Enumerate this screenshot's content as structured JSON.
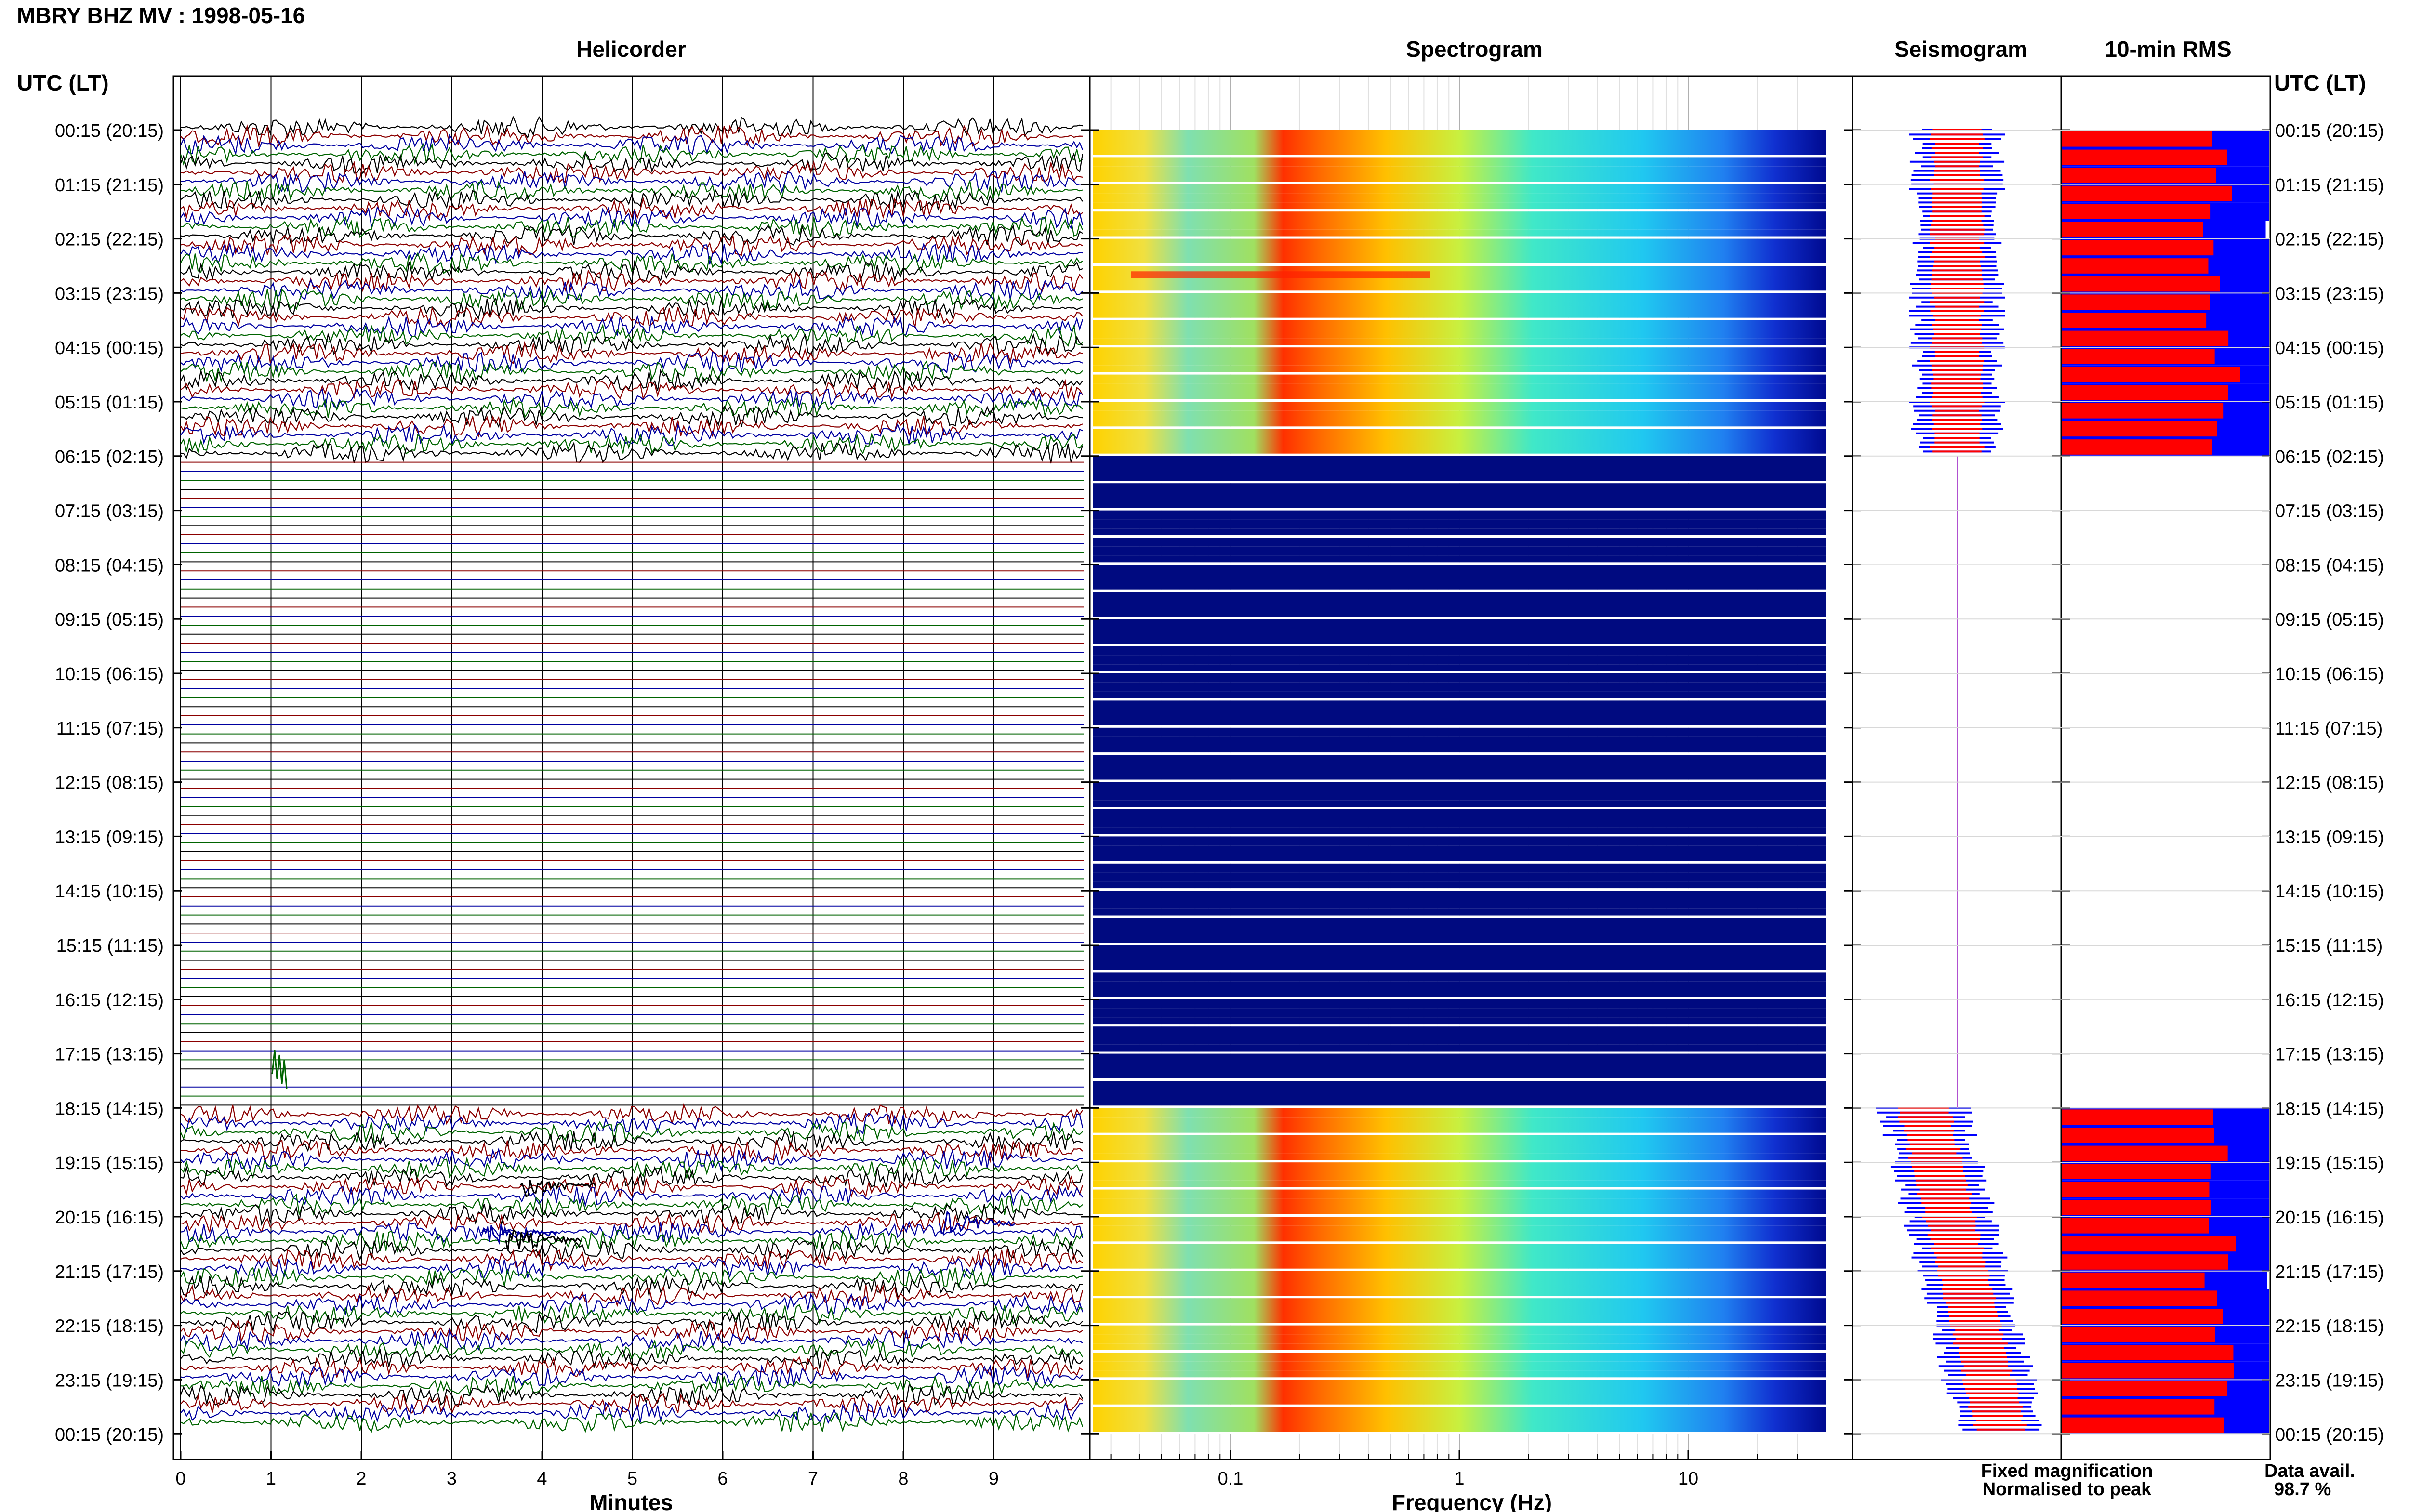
{
  "chart_data": {
    "type": "heatmap",
    "title": "MBRY BHZ MV : 1998-05-16",
    "panels": {
      "helicorder": "Helicorder",
      "spectrogram": "Spectrogram",
      "seismogram": "Seismogram",
      "rms": "10-min RMS"
    },
    "time_axis_label": "UTC (LT)",
    "time_ticks": [
      "00:15 (20:15)",
      "01:15 (21:15)",
      "02:15 (22:15)",
      "03:15 (23:15)",
      "04:15 (00:15)",
      "05:15 (01:15)",
      "06:15 (02:15)",
      "07:15 (03:15)",
      "08:15 (04:15)",
      "09:15 (05:15)",
      "10:15 (06:15)",
      "11:15 (07:15)",
      "12:15 (08:15)",
      "13:15 (09:15)",
      "14:15 (10:15)",
      "15:15 (11:15)",
      "16:15 (12:15)",
      "17:15 (13:15)",
      "18:15 (14:15)",
      "19:15 (15:15)",
      "20:15 (16:15)",
      "21:15 (17:15)",
      "22:15 (18:15)",
      "23:15 (19:15)",
      "00:15 (20:15)"
    ],
    "helicorder_xlabel": "Minutes",
    "helicorder_xticks": [
      "0",
      "1",
      "2",
      "3",
      "4",
      "5",
      "6",
      "7",
      "8",
      "9"
    ],
    "helicorder_xlim": [
      0,
      10
    ],
    "helicorder_trace_colors": [
      "#000000",
      "#8b0000",
      "#0000a0",
      "#006400"
    ],
    "spectrogram_xlabel": "Frequency (Hz)",
    "spectrogram_xscale": "log",
    "spectrogram_xticks": [
      "0.1",
      "1",
      "10"
    ],
    "spectrogram_xlim": [
      0.025,
      40
    ],
    "data_gap": {
      "start": "06:15",
      "end": "18:15"
    },
    "legend": {
      "fixed": "Fixed magnification",
      "normalised": "Normalised to peak",
      "fixed_color": "#0000ff",
      "normalised_color": "#ff0000"
    },
    "data_avail_label": "Data avail.",
    "data_avail_value": "98.7 %"
  }
}
